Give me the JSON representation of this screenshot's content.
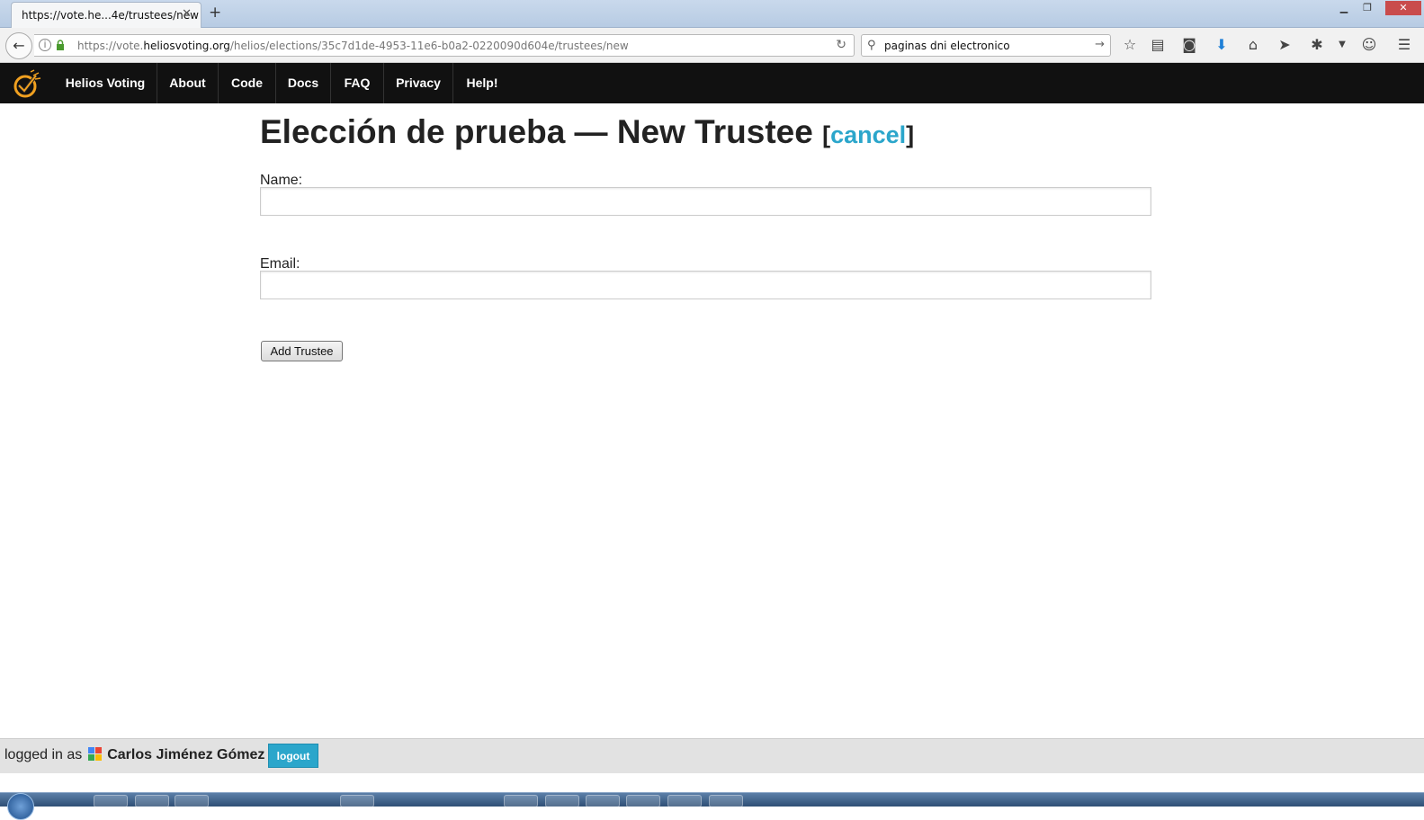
{
  "browser": {
    "tab_title": "https://vote.he...4e/trustees/new",
    "tab_close": "✕",
    "new_tab": "+",
    "url_prefix": "https://vote.",
    "url_domain": "heliosvoting.org",
    "url_path": "/helios/elections/35c7d1de-4953-11e6-b0a2-0220090d604e/trustees/new",
    "search_value": "paginas dni electronico"
  },
  "site_nav": {
    "brand": "Helios Voting",
    "items": [
      "About",
      "Code",
      "Docs",
      "FAQ",
      "Privacy",
      "Help!"
    ]
  },
  "page": {
    "title": "Elección de prueba — New Trustee",
    "cancel_open": "[",
    "cancel_label": "cancel",
    "cancel_close": "]",
    "name_label": "Name:",
    "email_label": "Email:",
    "submit_label": "Add Trustee"
  },
  "footer": {
    "logged_in_as": "logged in as",
    "user_name": "Carlos Jiménez Gómez",
    "logout_label": "logout"
  },
  "colors": {
    "accent": "#2ba6cb",
    "topbar": "#111111",
    "footer": "#e2e2e2"
  }
}
